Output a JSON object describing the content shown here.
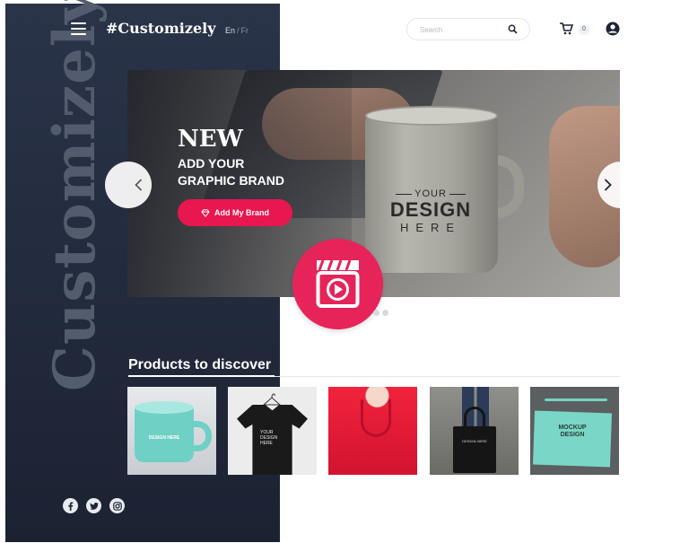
{
  "header": {
    "logo": "#Customizely",
    "lang_en": "En",
    "lang_sep": "/",
    "lang_fr": "Fr",
    "search_placeholder": "Search",
    "cart_count": "0"
  },
  "sidebar": {
    "vertical_brand": "Customizely"
  },
  "hero": {
    "headline": "NEW",
    "sub_line1": "ADD YOUR",
    "sub_line2": "GRAPHIC BRAND",
    "cta_label": "Add My Brand",
    "mug_line1": "YOUR",
    "mug_line2": "DESIGN",
    "mug_line3": "HERE"
  },
  "products": {
    "title": "Products to discover",
    "items": [
      {
        "name": "mug",
        "print": "DESIGN HERE"
      },
      {
        "name": "t-shirt",
        "print_lines": [
          "YOUR",
          "DESIGN",
          "HERE"
        ]
      },
      {
        "name": "hoodie"
      },
      {
        "name": "tote-bag",
        "print": "DESIGN HERE"
      },
      {
        "name": "notebook",
        "print_lines": [
          "MOCKUP",
          "DESIGN"
        ]
      }
    ]
  },
  "socials": [
    "facebook-icon",
    "twitter-icon",
    "instagram-icon"
  ],
  "colors": {
    "sidebar": "#232b3d",
    "accent": "#e9174f",
    "video_button": "#e6245a"
  }
}
